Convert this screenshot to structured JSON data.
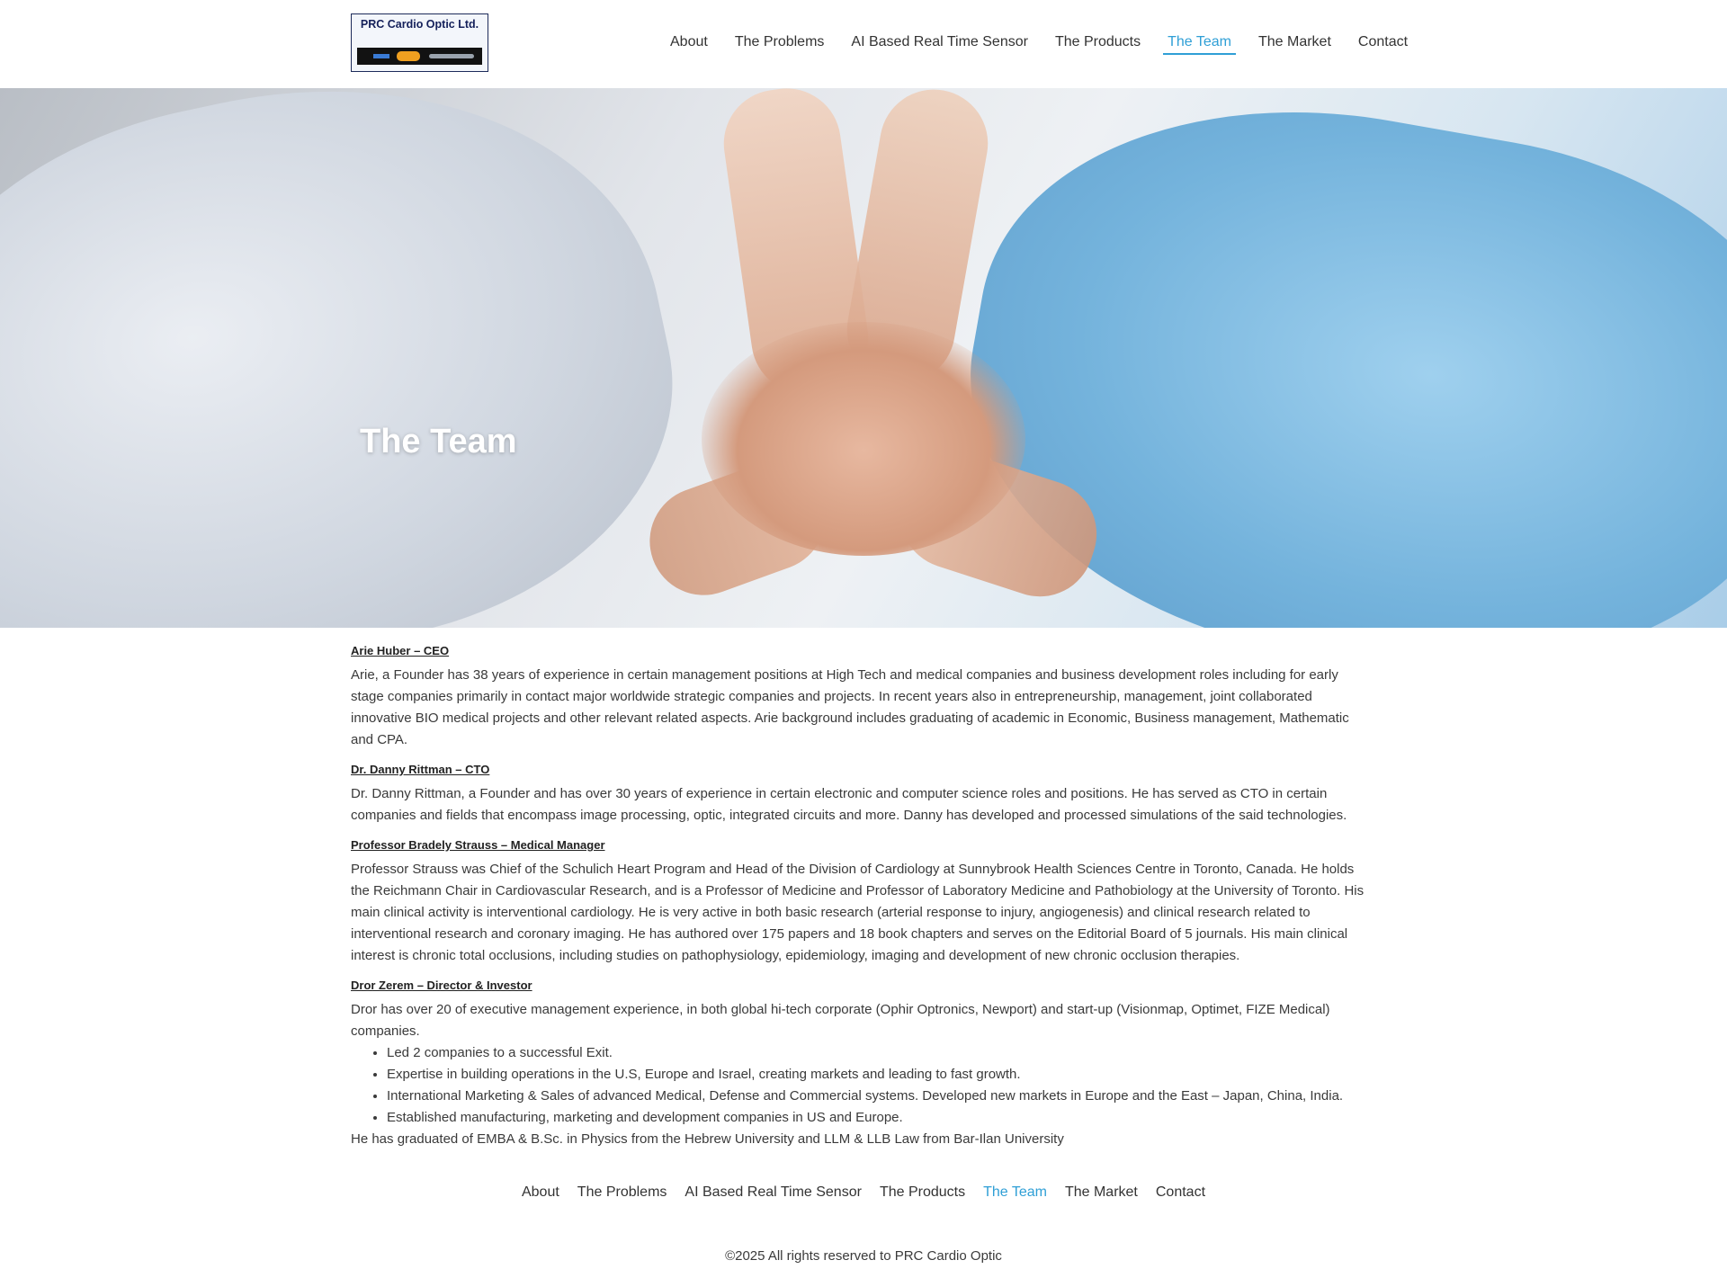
{
  "header": {
    "logo": {
      "title": "PRC Cardio Optic Ltd."
    },
    "nav": [
      {
        "label": "About",
        "active": false
      },
      {
        "label": "The Problems",
        "active": false
      },
      {
        "label": "AI Based Real Time Sensor",
        "active": false
      },
      {
        "label": "The Products",
        "active": false
      },
      {
        "label": "The Team",
        "active": true
      },
      {
        "label": "The Market",
        "active": false
      },
      {
        "label": "Contact",
        "active": false
      }
    ],
    "accent_color": "#2f9fd6"
  },
  "hero": {
    "title": "The Team"
  },
  "members": [
    {
      "name": "Arie Huber – CEO",
      "bio": "Arie, a Founder has 38 years of experience in certain management positions at High Tech and medical companies and business development roles including for early stage companies primarily in contact major worldwide strategic companies and projects. In recent years also in entrepreneurship, management, joint collaborated innovative BIO medical projects and other relevant related aspects. Arie background includes graduating of academic in Economic, Business management, Mathematic and CPA."
    },
    {
      "name": "Dr. Danny Rittman – CTO",
      "bio": "Dr. Danny Rittman, a Founder and has over 30 years of experience in certain electronic and computer science roles and positions. He has served as CTO in certain companies and fields that encompass image processing, optic, integrated circuits and more. Danny has developed and processed simulations of the said technologies."
    },
    {
      "name": "Professor Bradely Strauss – Medical Manager",
      "bio": "Professor Strauss was Chief of the Schulich Heart Program and Head of the Division of Cardiology at Sunnybrook Health Sciences Centre in Toronto, Canada. He holds the Reichmann Chair in Cardiovascular Research, and is a Professor of Medicine and Professor of Laboratory Medicine and Pathobiology at the University of Toronto. His main clinical activity is interventional cardiology. He is very active in both basic research (arterial response to injury, angiogenesis) and clinical research related to interventional research and coronary imaging. He has authored over 175 papers and 18 book chapters and serves on the Editorial Board of 5 journals. His main clinical interest is chronic total occlusions, including studies on pathophysiology, epidemiology, imaging and development of new chronic occlusion therapies."
    },
    {
      "name": "Dror Zerem – Director & Investor",
      "bio": "Dror has over 20 of executive management experience, in both global hi-tech corporate (Ophir Optronics, Newport) and start-up (Visionmap, Optimet, FIZE Medical) companies.",
      "bullets": [
        "Led 2 companies to a successful Exit.",
        "Expertise in building operations in the U.S, Europe and Israel, creating markets and leading to fast growth.",
        "International Marketing & Sales of advanced Medical, Defense and Commercial systems. Developed new markets in Europe and the East – Japan, China, India.",
        "Established manufacturing, marketing and development companies in US and Europe."
      ],
      "closing": "He has graduated of EMBA & B.Sc. in Physics from the Hebrew University and LLM & LLB Law from Bar-Ilan University"
    }
  ],
  "footer": {
    "nav": [
      {
        "label": "About"
      },
      {
        "label": "The Problems"
      },
      {
        "label": "AI Based Real Time Sensor"
      },
      {
        "label": "The Products"
      },
      {
        "label": "The Team"
      },
      {
        "label": "The Market"
      },
      {
        "label": "Contact"
      }
    ],
    "copyright": "©2025 All rights reserved to PRC Cardio Optic"
  }
}
